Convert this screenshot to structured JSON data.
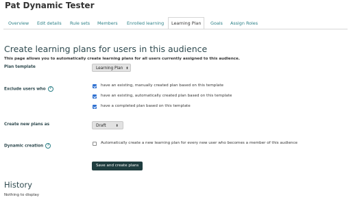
{
  "page": {
    "title": "Pat Dynamic Tester"
  },
  "tabs": [
    {
      "label": "Overview",
      "active": false
    },
    {
      "label": "Edit details",
      "active": false
    },
    {
      "label": "Rule sets",
      "active": false
    },
    {
      "label": "Members",
      "active": false
    },
    {
      "label": "Enrolled learning",
      "active": false
    },
    {
      "label": "Learning Plan",
      "active": true
    },
    {
      "label": "Goals",
      "active": false
    },
    {
      "label": "Assign Roles",
      "active": false
    }
  ],
  "main": {
    "heading": "Create learning plans for users in this audience",
    "description": "This page allows you to automatically create learning plans for all users currently assigned to this audience."
  },
  "form": {
    "plan_template": {
      "label": "Plan template",
      "value": "Learning Plan"
    },
    "exclude": {
      "label": "Exclude users who",
      "options": [
        {
          "text": "have an existing, manually created plan based on this template",
          "checked": true
        },
        {
          "text": "have an existing, automatically created plan based on this template",
          "checked": true
        },
        {
          "text": "have a completed plan based on this template",
          "checked": true
        }
      ]
    },
    "new_plans_as": {
      "label": "Create new plans as",
      "value": "Draft"
    },
    "dynamic_creation": {
      "label": "Dynamic creation",
      "option_text": "Automatically create a new learning plan for every new user who becomes a member of this audience",
      "checked": false
    },
    "submit_label": "Save and create plans"
  },
  "history": {
    "heading": "History",
    "empty_text": "Nothing to display"
  },
  "icons": {
    "help": "help-question-icon",
    "dropdown": "dropdown-caret-icon",
    "check": "checkmark-icon"
  },
  "colors": {
    "accent_teal": "#2a7f86",
    "primary_button": "#1f3d3f",
    "checkbox_blue": "#2d6fd0"
  }
}
